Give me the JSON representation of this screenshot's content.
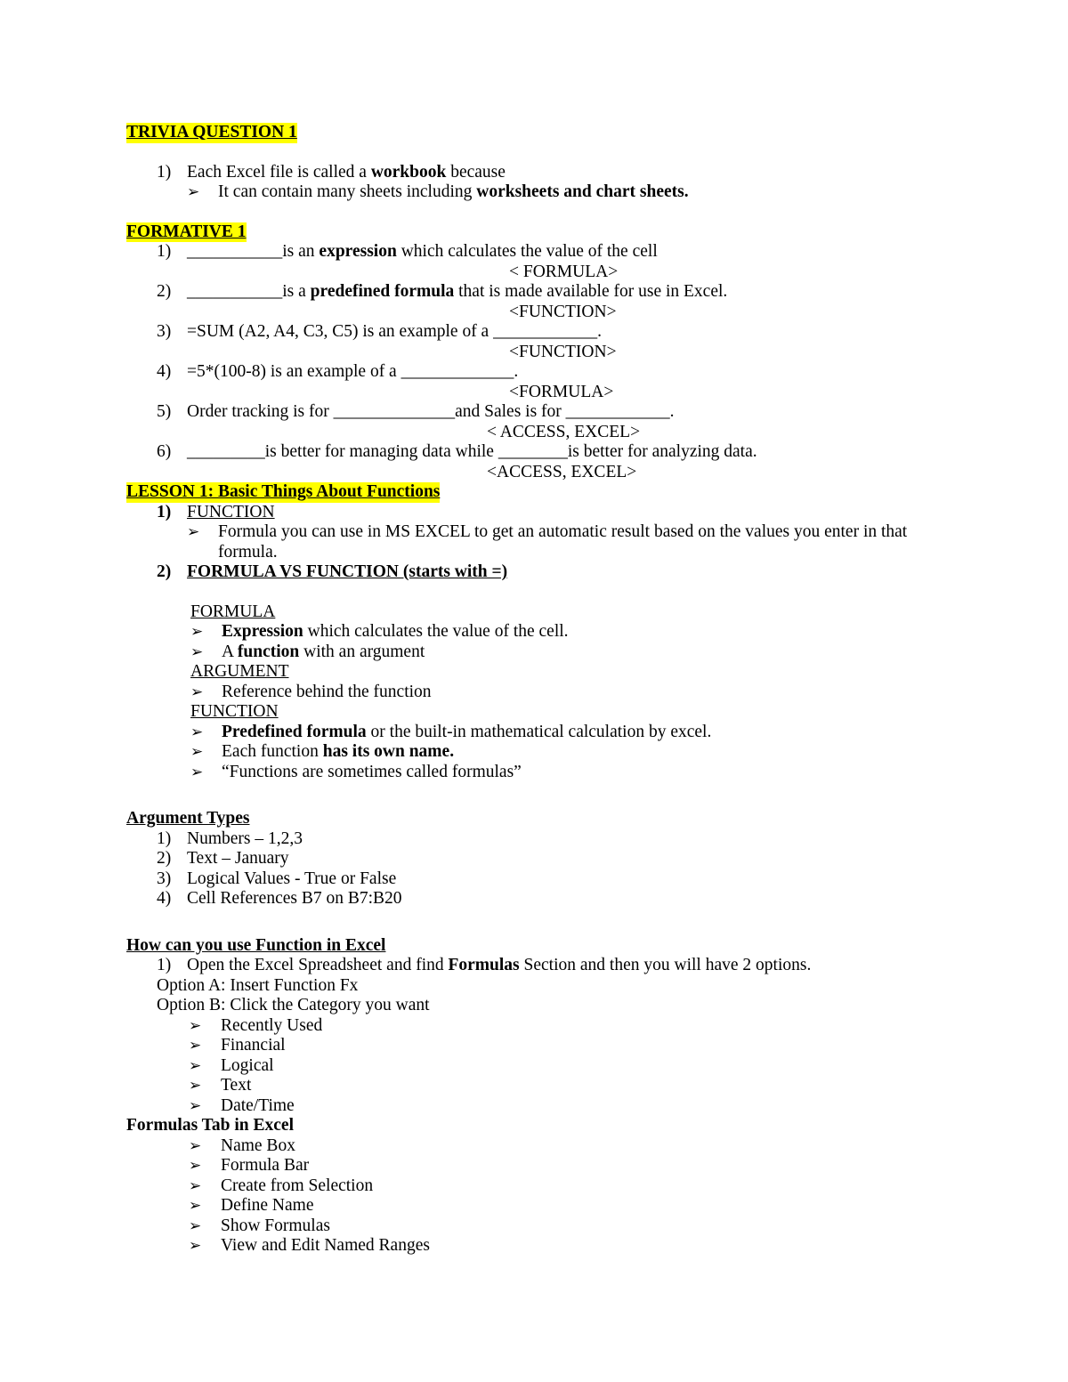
{
  "document": {
    "title": "Excel Functions Notes",
    "highlight_color": "#FFFF00",
    "text_color": "#000000",
    "background_color": "#FFFFFF"
  },
  "sections": {
    "trivia": {
      "heading": "TRIVIA QUESTION 1",
      "q1_marker": "1)",
      "q1_pre": "Each Excel file is called a ",
      "q1_bold": "workbook",
      "q1_post": " because",
      "a1_marker": "➢",
      "a1_pre": "It can contain many sheets including ",
      "a1_bold": "worksheets and chart sheets."
    },
    "formative": {
      "heading": "FORMATIVE 1",
      "items": [
        {
          "marker": "1)",
          "blank": "___________",
          "pre": "is an ",
          "bold": "expression",
          "post": " which calculates the value of the cell",
          "answer": "< FORMULA>"
        },
        {
          "marker": "2)",
          "blank": "___________",
          "pre": "is a ",
          "bold": "predefined formula",
          "post": " that is made available for use in Excel.",
          "answer": "<FUNCTION>"
        },
        {
          "marker": "3)",
          "pre": "=SUM (A2, A4, C3, C5) is an example of a ",
          "blank": "____________",
          "post": ".",
          "answer": "<FUNCTION>"
        },
        {
          "marker": "4)",
          "pre": "=5*(100-8) is an example of a ",
          "blank": "_____________",
          "post": ".",
          "answer": "<FORMULA>"
        },
        {
          "marker": "5)",
          "pre": "Order tracking is for ",
          "blank": "______________",
          "mid": "and Sales is for ",
          "blank2": "____________",
          "post": ".",
          "answer": "< ACCESS, EXCEL>"
        },
        {
          "marker": "6)",
          "blank": "_________",
          "pre": "is better for managing data while ",
          "blank2": "________",
          "post": "is better for analyzing data.",
          "answer": "<ACCESS, EXCEL>"
        }
      ]
    },
    "lesson1": {
      "heading": "LESSON 1: Basic Things About Functions",
      "item1_marker": "1)",
      "item1_title": "FUNCTION",
      "item1_bullet_marker": "➢",
      "item1_bullet_text": "Formula you can use in MS EXCEL to get an automatic result based on the values you enter in that formula.",
      "item2_marker": "2)",
      "item2_title": "FORMULA VS FUNCTION (starts with =)",
      "formula_head": "FORMULA",
      "formula_bullets": [
        {
          "marker": "➢",
          "bold": "Expression",
          "rest": " which calculates the value of the cell."
        },
        {
          "marker": "➢",
          "pre": "A ",
          "bold": "function",
          "rest": " with an argument"
        }
      ],
      "argument_head": "ARGUMENT",
      "argument_bullets": [
        {
          "marker": "➢",
          "text": "Reference behind the function"
        }
      ],
      "function_head": "FUNCTION",
      "function_bullets": [
        {
          "marker": "➢",
          "bold": "Predefined formula",
          "rest": " or the built-in mathematical calculation by excel."
        },
        {
          "marker": "➢",
          "pre": "Each function ",
          "bold": "has its own name."
        },
        {
          "marker": "➢",
          "text": "“Functions are sometimes called formulas”"
        }
      ]
    },
    "argument_types": {
      "heading": "Argument Types",
      "items": [
        {
          "marker": "1)",
          "text": "Numbers – 1,2,3"
        },
        {
          "marker": "2)",
          "text": "Text – January"
        },
        {
          "marker": "3)",
          "text": "Logical Values - True or False"
        },
        {
          "marker": "4)",
          "text": "Cell References B7 on B7:B20"
        }
      ]
    },
    "how_use": {
      "heading": "How can you use Function in Excel",
      "step1_marker": "1)",
      "step1_pre": "Open the Excel Spreadsheet and find ",
      "step1_bold": "Formulas",
      "step1_post": " Section and then you will have 2 options.",
      "option_a": "Option A: Insert Function Fx",
      "option_b": "Option B: Click the Category you want",
      "categories": [
        {
          "marker": "➢",
          "text": "Recently Used"
        },
        {
          "marker": "➢",
          "text": "Financial"
        },
        {
          "marker": "➢",
          "text": "Logical"
        },
        {
          "marker": "➢",
          "text": "Text"
        },
        {
          "marker": "➢",
          "text": "Date/Time"
        }
      ]
    },
    "formulas_tab": {
      "heading": "Formulas Tab in Excel",
      "items": [
        {
          "marker": "➢",
          "text": "Name Box"
        },
        {
          "marker": "➢",
          "text": "Formula Bar"
        },
        {
          "marker": "➢",
          "text": "Create from Selection"
        },
        {
          "marker": "➢",
          "text": "Define Name"
        },
        {
          "marker": "➢",
          "text": "Show Formulas"
        },
        {
          "marker": "➢",
          "text": "View and Edit Named Ranges"
        }
      ]
    }
  }
}
